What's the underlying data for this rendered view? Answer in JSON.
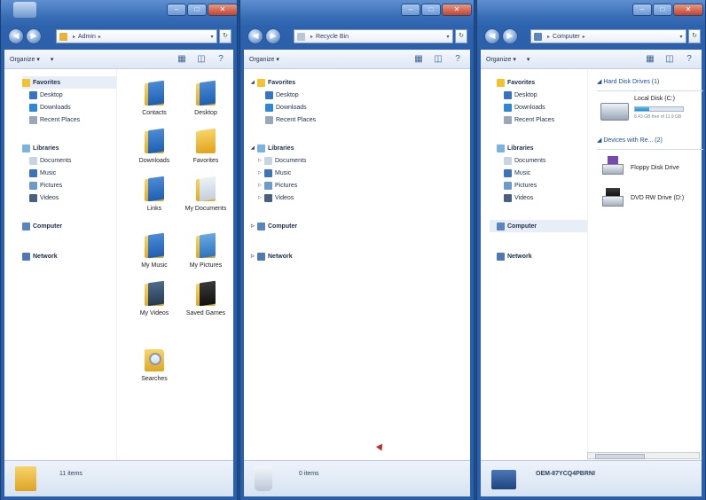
{
  "windows": [
    {
      "address_segments": [
        "Admin"
      ],
      "command_bar": {
        "organize": "Organize ▾",
        "view_toggle": "▾"
      },
      "nav": {
        "favorites": "Favorites",
        "favorites_items": [
          "Desktop",
          "Downloads",
          "Recent Places"
        ],
        "libraries": "Libraries",
        "libraries_items": [
          "Documents",
          "Music",
          "Pictures",
          "Videos"
        ],
        "computer": "Computer",
        "network": "Network"
      },
      "folders": [
        "Contacts",
        "Desktop",
        "Downloads",
        "Favorites",
        "Links",
        "My Documents",
        "My Music",
        "My Pictures",
        "My Videos",
        "Saved Games",
        "Searches"
      ],
      "status": "11 items"
    },
    {
      "address_segments": [
        "Recycle Bin"
      ],
      "command_bar": {
        "organize": "Organize ▾"
      },
      "nav": {
        "favorites": "Favorites",
        "favorites_items": [
          "Desktop",
          "Downloads",
          "Recent Places"
        ],
        "libraries": "Libraries",
        "libraries_items": [
          "Documents",
          "Music",
          "Pictures",
          "Videos"
        ],
        "computer": "Computer",
        "network": "Network"
      },
      "status": "0 items"
    },
    {
      "address_segments": [
        "Computer"
      ],
      "command_bar": {
        "organize": "Organize ▾",
        "view_toggle": "▾"
      },
      "nav": {
        "favorites": "Favorites",
        "favorites_items": [
          "Desktop",
          "Downloads",
          "Recent Places"
        ],
        "libraries": "Libraries",
        "libraries_items": [
          "Documents",
          "Music",
          "Pictures",
          "Videos"
        ],
        "computer": "Computer",
        "network": "Network"
      },
      "hard_disk_header": "Hard Disk Drives (1)",
      "local_disk": {
        "name": "Local Disk (C:)",
        "free_text": "8.43 GB free of 11.9 GB",
        "used_fraction": 0.29
      },
      "removable_header": "Devices with Re... (2)",
      "devices": [
        "Floppy Disk Drive",
        "DVD RW Drive (D:)"
      ],
      "status": "OEM-87YCQ4PBRNI"
    }
  ],
  "caption_buttons": {
    "minimize": "–",
    "maximize": "□",
    "close": "✕"
  },
  "nav_buttons": {
    "back": "◀",
    "forward": "▶"
  },
  "refresh_icon": "↻",
  "colors": {
    "frame": "#2c5fa9",
    "accent": "#1d4f99",
    "folder": "#e0a823"
  }
}
